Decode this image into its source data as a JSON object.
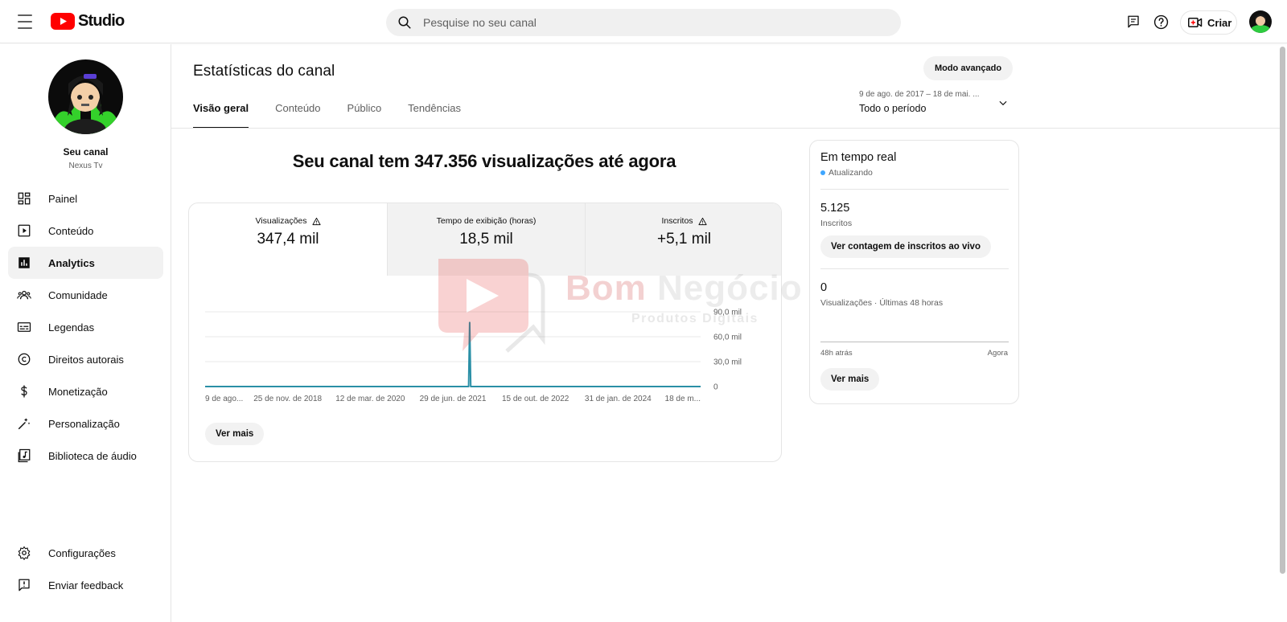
{
  "topbar": {
    "logo_text": "Studio",
    "search_placeholder": "Pesquise no seu canal",
    "create_label": "Criar"
  },
  "sidebar": {
    "channel_title": "Seu canal",
    "channel_name": "Nexus Tv",
    "items": [
      {
        "label": "Painel",
        "icon": "dashboard-icon"
      },
      {
        "label": "Conteúdo",
        "icon": "content-icon"
      },
      {
        "label": "Analytics",
        "icon": "analytics-icon",
        "active": true
      },
      {
        "label": "Comunidade",
        "icon": "community-icon"
      },
      {
        "label": "Legendas",
        "icon": "subtitles-icon"
      },
      {
        "label": "Direitos autorais",
        "icon": "copyright-icon"
      },
      {
        "label": "Monetização",
        "icon": "monetization-icon"
      },
      {
        "label": "Personalização",
        "icon": "customization-icon"
      },
      {
        "label": "Biblioteca de áudio",
        "icon": "audio-library-icon"
      }
    ],
    "bottom_items": [
      {
        "label": "Configurações",
        "icon": "settings-icon"
      },
      {
        "label": "Enviar feedback",
        "icon": "feedback-icon"
      }
    ]
  },
  "main": {
    "title": "Estatísticas do canal",
    "advanced_mode_label": "Modo avançado",
    "tabs": [
      {
        "label": "Visão geral",
        "active": true
      },
      {
        "label": "Conteúdo"
      },
      {
        "label": "Público"
      },
      {
        "label": "Tendências"
      }
    ],
    "date_range": {
      "range_text": "9 de ago. de 2017 – 18 de mai. ...",
      "period_label": "Todo o período"
    },
    "headline": "Seu canal tem 347.356 visualizações até agora",
    "metrics": [
      {
        "label": "Visualizações",
        "value": "347,4 mil",
        "warning": true
      },
      {
        "label": "Tempo de exibição (horas)",
        "value": "18,5 mil",
        "warning": false
      },
      {
        "label": "Inscritos",
        "value": "+5,1 mil",
        "warning": true
      }
    ],
    "see_more_label": "Ver mais"
  },
  "chart_data": {
    "type": "line",
    "x_tick_labels": [
      "9 de ago...",
      "25 de nov. de 2018",
      "12 de mar. de 2020",
      "29 de jun. de 2021",
      "15 de out. de 2022",
      "31 de jan. de 2024",
      "18 de m..."
    ],
    "y_tick_labels": [
      "0",
      "30,0 mil",
      "60,0 mil",
      "90,0 mil"
    ],
    "y_ticks": [
      0,
      30000,
      60000,
      90000
    ],
    "ylim": [
      0,
      90000
    ],
    "series": [
      {
        "values": [
          {
            "x": "2017-08-09",
            "y": 0
          },
          {
            "x": "2021-09-27",
            "y": 0
          },
          {
            "x": "2021-10-03",
            "y": 77000
          },
          {
            "x": "2021-10-09",
            "y": 0
          },
          {
            "x": "2025-05-18",
            "y": 0
          }
        ]
      }
    ],
    "line_color": "#2a8fa6",
    "grid": true
  },
  "realtime": {
    "title": "Em tempo real",
    "status": "Atualizando",
    "subscribers_value": "5.125",
    "subscribers_label": "Inscritos",
    "live_count_button": "Ver contagem de inscritos ao vivo",
    "views_value": "0",
    "views_label": "Visualizações · Últimas 48 horas",
    "axis_left": "48h atrás",
    "axis_right": "Agora",
    "see_more_label": "Ver mais"
  },
  "watermark": {
    "word1": "Bom",
    "word2": "Negócio",
    "subtitle": "Produtos Digitais"
  },
  "colors": {
    "brand_red": "#ff0000",
    "chart_line": "#2a8fa6",
    "realtime_dot": "#3ea6ff"
  }
}
